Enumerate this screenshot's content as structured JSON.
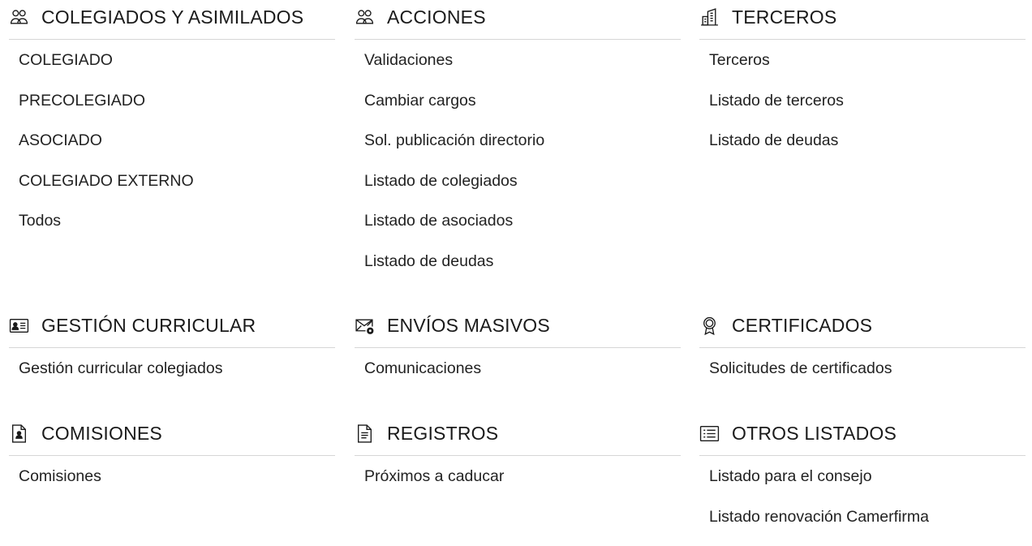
{
  "sections": [
    {
      "id": "colegiados",
      "icon": "users-icon",
      "title": "COLEGIADOS Y ASIMILADOS",
      "items": [
        "COLEGIADO",
        "PRECOLEGIADO",
        "ASOCIADO",
        "COLEGIADO EXTERNO",
        "Todos"
      ]
    },
    {
      "id": "acciones",
      "icon": "users-icon",
      "title": "ACCIONES",
      "items": [
        "Validaciones",
        "Cambiar cargos",
        "Sol. publicación directorio",
        "Listado de colegiados",
        "Listado de asociados",
        "Listado de deudas"
      ]
    },
    {
      "id": "terceros",
      "icon": "building-icon",
      "title": "TERCEROS",
      "items": [
        "Terceros",
        "Listado de terceros",
        "Listado de deudas"
      ]
    },
    {
      "id": "gestion-curricular",
      "icon": "id-card-icon",
      "title": "GESTIÓN CURRICULAR",
      "items": [
        "Gestión curricular colegiados"
      ]
    },
    {
      "id": "envios-masivos",
      "icon": "mail-settings-icon",
      "title": "ENVÍOS MASIVOS",
      "items": [
        "Comunicaciones"
      ]
    },
    {
      "id": "certificados",
      "icon": "award-icon",
      "title": "CERTIFICADOS",
      "items": [
        "Solicitudes de certificados"
      ]
    },
    {
      "id": "comisiones",
      "icon": "document-user-icon",
      "title": "COMISIONES",
      "items": [
        "Comisiones"
      ]
    },
    {
      "id": "registros",
      "icon": "document-text-icon",
      "title": "REGISTROS",
      "items": [
        "Próximos a caducar"
      ]
    },
    {
      "id": "otros-listados",
      "icon": "list-icon",
      "title": "OTROS LISTADOS",
      "items": [
        "Listado para el consejo",
        "Listado renovación Camerfirma"
      ]
    }
  ]
}
